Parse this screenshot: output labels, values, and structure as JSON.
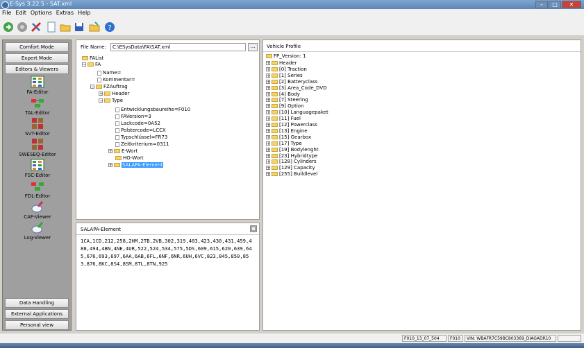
{
  "window": {
    "title": "E-Sys 3.22.5 - SAT.xml",
    "minimize": "–",
    "maximize": "□",
    "close": "✕"
  },
  "menu": {
    "file": "File",
    "edit": "Edit",
    "options": "Options",
    "extras": "Extras",
    "help": "Help"
  },
  "toolbar": {
    "icons": [
      "go-icon",
      "stop-icon",
      "connect-icon",
      "new-icon",
      "open-icon",
      "save-icon",
      "open-folder-icon",
      "help-icon"
    ]
  },
  "left": {
    "comfort_mode": "Comfort Mode",
    "expert_mode": "Expert Mode",
    "editors_viewers": "Editors & Viewers",
    "tools": [
      "FA-Editor",
      "TAL-Editor",
      "SVT-Editor",
      "SWESEQ-Editor",
      "FSC-Editor",
      "FDL-Editor",
      "CAF-Viewer",
      "Log-Viewer"
    ],
    "data_handling": "Data Handling",
    "external_apps": "External Applications",
    "personal_view": "Personal view"
  },
  "file": {
    "label": "File Name:",
    "value": "C:\\ESysData\\FA\\SAT.xml",
    "browse": "..."
  },
  "fa_tree": [
    {
      "label": "FAList",
      "type": "folder"
    },
    {
      "label": "FA",
      "type": "folder"
    },
    {
      "label": "Name=",
      "type": "leaf"
    },
    {
      "label": "Kommentar=",
      "type": "leaf"
    },
    {
      "label": "FZAuftrag",
      "type": "folder"
    },
    {
      "label": "Header",
      "type": "folder"
    },
    {
      "label": "Type",
      "type": "folder"
    },
    {
      "label": "Entwicklungsbaureihe=F010",
      "type": "leaf"
    },
    {
      "label": "FAVersion=3",
      "type": "leaf"
    },
    {
      "label": "Lackcode=0A52",
      "type": "leaf"
    },
    {
      "label": "Polstercode=LCCX",
      "type": "leaf"
    },
    {
      "label": "Typschlüssel=FR73",
      "type": "leaf"
    },
    {
      "label": "Zeitkriterium=0311",
      "type": "leaf"
    },
    {
      "label": "E-Wort",
      "type": "folder"
    },
    {
      "label": "HO-Wort",
      "type": "folder"
    },
    {
      "label": "SALAPA-Element",
      "type": "folder"
    }
  ],
  "salapa": {
    "title": "SALAPA-Element",
    "text": "1CA,1CD,212,258,2HM,2TB,2VB,302,319,403,423,430,431,459,488,494,4BN,4NE,4UR,522,524,534,575,5DS,609,615,620,639,645,676,693,697,6AA,6AB,6FL,6NF,6NR,6UH,6VC,823,845,850,853,876,8KC,8S4,8SM,8TL,8TN,925"
  },
  "vehicle": {
    "title": "Vehicle Profile",
    "root": "FP_Version: 1",
    "items": [
      "Header",
      "[0] Traction",
      "[1] Series",
      "[2] Batteryclass",
      "[3] Area_Code_DVD",
      "[4] Body",
      "[7] Steering",
      "[9] Option",
      "[10] Languagepaket",
      "[11] Fuel",
      "[12] Powerclass",
      "[13] Engine",
      "[15] Gearbox",
      "[17] Type",
      "[19] Bodylenght",
      "[23] Hybridtype",
      "[128] Cylinders",
      "[129] Capacity",
      "[255] Buildlevel"
    ]
  },
  "status": {
    "s1": "F010_13_07_504",
    "s2": "F010",
    "s3": "VIN: WBAFR7C59BC803369_DIAGADR10"
  }
}
